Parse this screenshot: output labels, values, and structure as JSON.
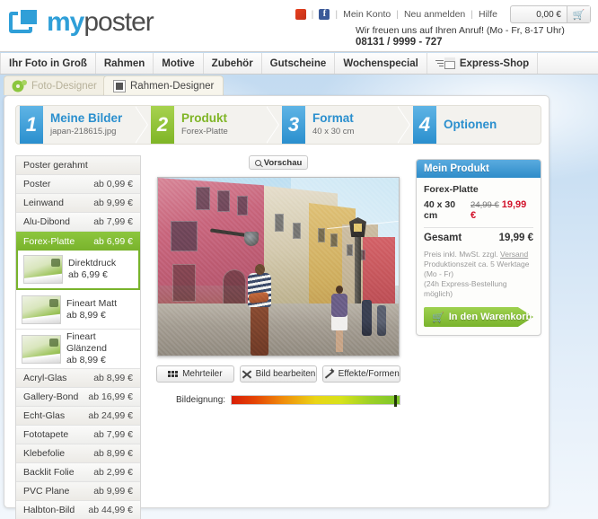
{
  "header": {
    "brand_my": "my",
    "brand_poster": "poster",
    "social": [
      {
        "name": "mister-wong-icon",
        "glyph": ""
      },
      {
        "name": "facebook-icon",
        "glyph": "f"
      }
    ],
    "links": [
      {
        "label": "Mein Konto"
      },
      {
        "label": "Neu anmelden"
      },
      {
        "label": "Hilfe"
      }
    ],
    "cart_amount": "0,00 €",
    "cart_icon": "cart-icon",
    "phone_text": "Wir freuen uns auf Ihren Anruf! (Mo - Fr, 8-17 Uhr)",
    "phone_number": "08131 / 9999 - 727"
  },
  "mainnav": {
    "items": [
      {
        "label": "Ihr Foto in Groß"
      },
      {
        "label": "Rahmen"
      },
      {
        "label": "Motive"
      },
      {
        "label": "Zubehör"
      },
      {
        "label": "Gutscheine"
      },
      {
        "label": "Wochenspecial"
      }
    ],
    "express_label": "Express-Shop"
  },
  "designer_tabs": [
    {
      "label": "Foto-Designer",
      "active": true,
      "icon": "gears-icon"
    },
    {
      "label": "Rahmen-Designer",
      "active": false,
      "icon": "frame-icon"
    }
  ],
  "steps": [
    {
      "num": "1",
      "title": "Meine Bilder",
      "sub": "japan-218615.jpg",
      "color": "blue"
    },
    {
      "num": "2",
      "title": "Produkt",
      "sub": "Forex-Platte",
      "color": "green"
    },
    {
      "num": "3",
      "title": "Format",
      "sub": "40 x 30 cm",
      "color": "blue"
    },
    {
      "num": "4",
      "title": "Optionen",
      "sub": "",
      "color": "blue"
    }
  ],
  "product_list": [
    {
      "label": "Poster gerahmt",
      "price": "",
      "selected": false,
      "type": "row"
    },
    {
      "label": "Poster",
      "price": "ab 0,99 €",
      "selected": false,
      "type": "row"
    },
    {
      "label": "Leinwand",
      "price": "ab 9,99 €",
      "selected": false,
      "type": "row"
    },
    {
      "label": "Alu-Dibond",
      "price": "ab 7,99 €",
      "selected": false,
      "type": "row"
    },
    {
      "label": "Forex-Platte",
      "price": "ab 6,99 €",
      "selected": true,
      "type": "row"
    },
    {
      "label": "Direktdruck",
      "price": "ab 6,99 €",
      "selected": true,
      "type": "sub"
    },
    {
      "label": "Fineart Matt",
      "price": "ab 8,99 €",
      "selected": false,
      "type": "sub"
    },
    {
      "label": "Fineart Glänzend",
      "price": "ab 8,99 €",
      "selected": false,
      "type": "sub"
    },
    {
      "label": "Acryl-Glas",
      "price": "ab 8,99 €",
      "selected": false,
      "type": "row"
    },
    {
      "label": "Gallery-Bond",
      "price": "ab 16,99 €",
      "selected": false,
      "type": "row"
    },
    {
      "label": "Echt-Glas",
      "price": "ab 24,99 €",
      "selected": false,
      "type": "row"
    },
    {
      "label": "Fototapete",
      "price": "ab 7,99 €",
      "selected": false,
      "type": "row"
    },
    {
      "label": "Klebefolie",
      "price": "ab 8,99 €",
      "selected": false,
      "type": "row"
    },
    {
      "label": "Backlit Folie",
      "price": "ab 2,99 €",
      "selected": false,
      "type": "row"
    },
    {
      "label": "PVC Plane",
      "price": "ab 9,99 €",
      "selected": false,
      "type": "row"
    },
    {
      "label": "Halbton-Bild",
      "price": "ab 44,99 €",
      "selected": false,
      "type": "row"
    }
  ],
  "preview": {
    "vorschau_label": "Vorschau",
    "vorschau_icon": "magnifier-icon",
    "image_alt": "Venezianische Gasse mit rosa Hauswand und Passanten"
  },
  "tools": [
    {
      "label": "Mehrteiler",
      "icon": "grid-icon"
    },
    {
      "label": "Bild bearbeiten",
      "icon": "tools-icon"
    },
    {
      "label": "Effekte/Formen",
      "icon": "magic-wand-icon"
    }
  ],
  "suitability": {
    "label": "Bildeignung:",
    "value_position_pct": 97,
    "gradient_from": "#d81f06",
    "gradient_to": "#7cc62b"
  },
  "my_product": {
    "title": "Mein Produkt",
    "product_name": "Forex-Platte",
    "size": "40 x 30 cm",
    "old_price": "24,99 €",
    "new_price": "19,99 €",
    "total_label": "Gesamt",
    "total_price": "19,99 €",
    "fine_print_1_pre": "Preis inkl. MwSt. zzgl. ",
    "fine_print_1_link": "Versand",
    "fine_print_2": "Produktionszeit ca. 5 Werktage (Mo - Fr)",
    "fine_print_3": "(24h Express-Bestellung möglich)",
    "cart_button": "In den Warenkorb",
    "cart_button_icon": "cart-icon",
    "accent_color": "#2e8cc9",
    "cart_color": "#79b32c",
    "price_color": "#d2122a"
  }
}
